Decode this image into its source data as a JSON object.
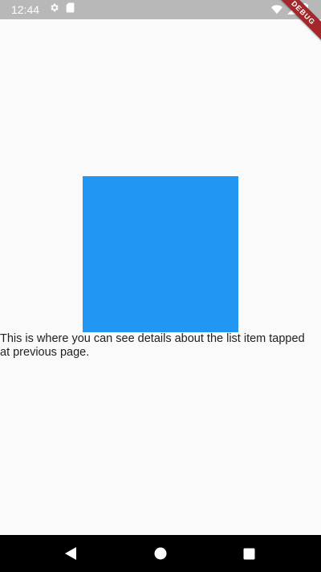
{
  "status_bar": {
    "time": "12:44",
    "icons": [
      "gear-icon",
      "sd-card-icon",
      "wifi-icon",
      "signal-icon",
      "battery-icon"
    ],
    "background": "#b8b8b8"
  },
  "debug_banner": {
    "label": "DEBUG",
    "color": "#a3272b"
  },
  "detail": {
    "square_color": "#2196f3",
    "description": "This is where you can see details about the list item tapped at previous page."
  },
  "nav_bar": {
    "buttons": [
      "back-icon",
      "home-icon",
      "recents-icon"
    ]
  }
}
